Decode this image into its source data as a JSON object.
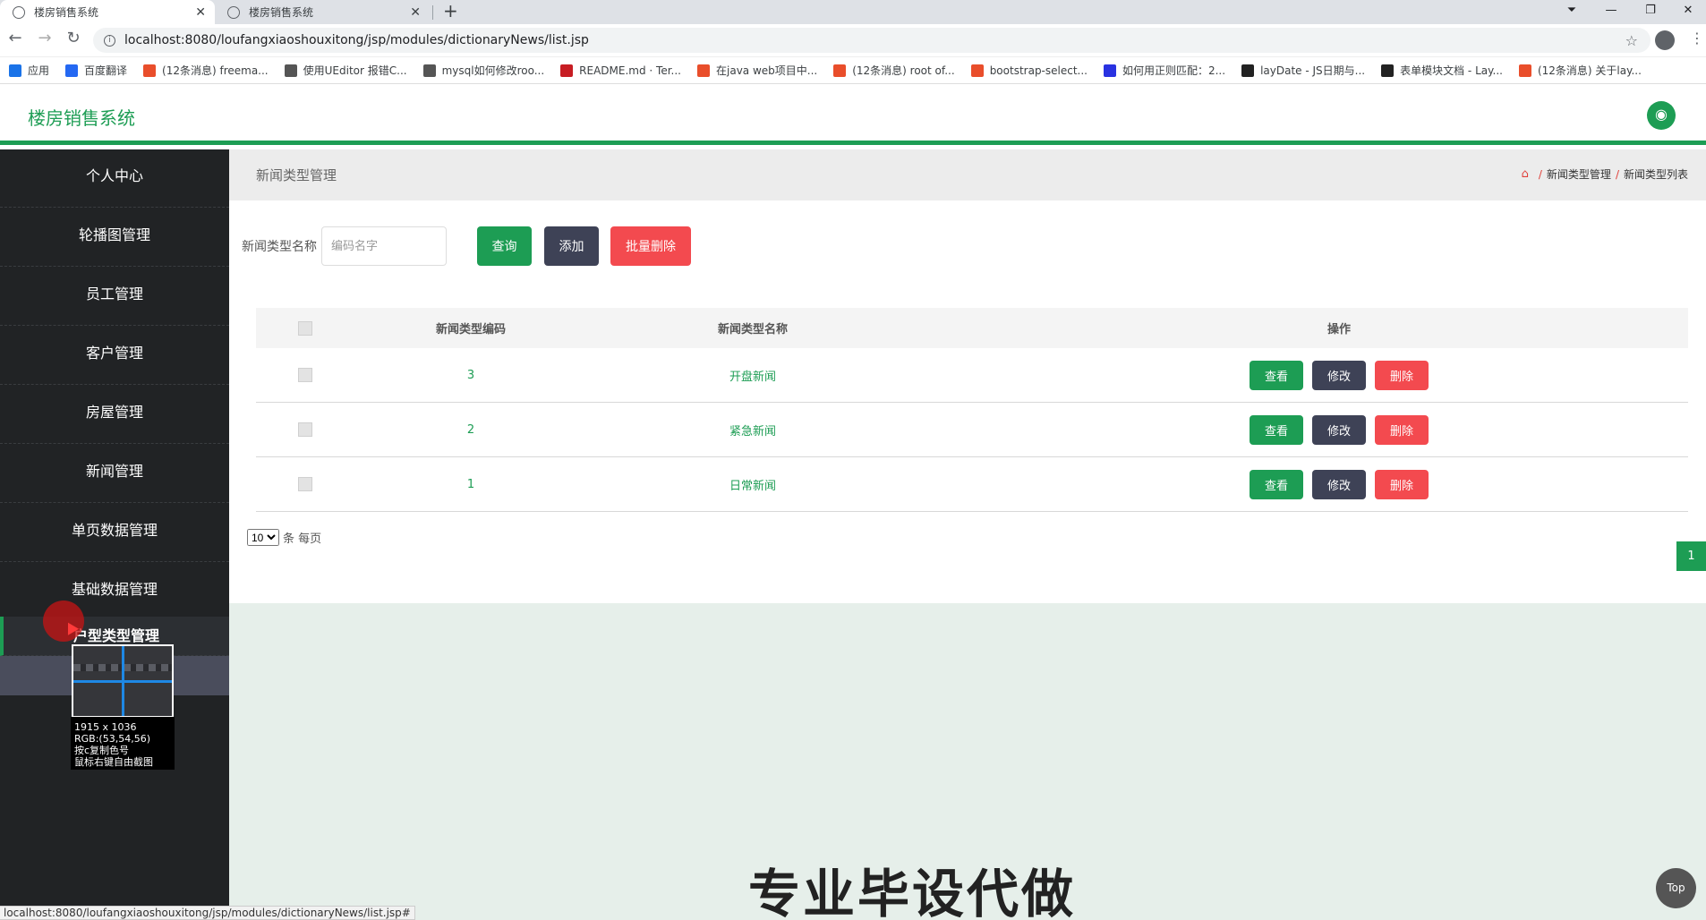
{
  "browser": {
    "tabs": [
      {
        "title": "楼房销售系统",
        "active": true
      },
      {
        "title": "楼房销售系统",
        "active": false
      }
    ],
    "new_tab": "+",
    "url": "localhost:8080/loufangxiaoshouxitong/jsp/modules/dictionaryNews/list.jsp",
    "bookmarks": [
      {
        "label": "应用",
        "icon": "apps-grid-icon",
        "color": "#1a73e8"
      },
      {
        "label": "百度翻译",
        "icon": "baidu-translate-icon",
        "color": "#2468f2"
      },
      {
        "label": "(12条消息) freema...",
        "icon": "csdn-icon",
        "color": "#e94e2b"
      },
      {
        "label": "使用UEditor 报错C...",
        "icon": "ueditor-icon",
        "color": "#555555"
      },
      {
        "label": "mysql如何修改roo...",
        "icon": "mysql-icon",
        "color": "#555555"
      },
      {
        "label": "README.md · Ter...",
        "icon": "gitee-icon",
        "color": "#c71d23"
      },
      {
        "label": "在java web项目中...",
        "icon": "csdn-icon",
        "color": "#e94e2b"
      },
      {
        "label": "(12条消息) root of...",
        "icon": "csdn-icon",
        "color": "#e94e2b"
      },
      {
        "label": "bootstrap-select...",
        "icon": "bootstrap-icon",
        "color": "#e94e2b"
      },
      {
        "label": "如何用正则匹配：2...",
        "icon": "baidu-icon",
        "color": "#2932e1"
      },
      {
        "label": "layDate - JS日期与...",
        "icon": "layui-icon",
        "color": "#222222"
      },
      {
        "label": "表单模块文档 - Lay...",
        "icon": "layui-icon",
        "color": "#222222"
      },
      {
        "label": "(12条消息) 关于lay...",
        "icon": "csdn-icon",
        "color": "#e94e2b"
      }
    ],
    "status_url": "localhost:8080/loufangxiaoshouxitong/jsp/modules/dictionaryNews/list.jsp#"
  },
  "app": {
    "title": "楼房销售系统",
    "accent": "#1d9d54"
  },
  "sidebar": {
    "items": [
      {
        "label": "个人中心"
      },
      {
        "label": "轮播图管理"
      },
      {
        "label": "员工管理"
      },
      {
        "label": "客户管理"
      },
      {
        "label": "房屋管理"
      },
      {
        "label": "新闻管理"
      },
      {
        "label": "单页数据管理"
      },
      {
        "label": "基础数据管理"
      },
      {
        "label": "户型类型管理"
      }
    ]
  },
  "screenshot_tool": {
    "size": "1915 x 1036",
    "rgb": "RGB:(53,54,56)",
    "hint1": "按c复制色号",
    "hint2": "鼠标右键自由截图"
  },
  "page": {
    "title": "新闻类型管理",
    "breadcrumb": [
      "新闻类型管理",
      "新闻类型列表"
    ],
    "search_label": "新闻类型名称",
    "search_placeholder": "编码名字",
    "search_button": "查询",
    "add_button": "添加",
    "batch_delete_button": "批量删除"
  },
  "table": {
    "headers": [
      "新闻类型编码",
      "新闻类型名称",
      "操作"
    ],
    "rows": [
      {
        "code": "3",
        "name": "开盘新闻"
      },
      {
        "code": "2",
        "name": "紧急新闻"
      },
      {
        "code": "1",
        "name": "日常新闻"
      }
    ],
    "actions": {
      "view": "查看",
      "edit": "修改",
      "delete": "删除"
    }
  },
  "pager": {
    "page_size": "10",
    "per_page_label": "条 每页",
    "current_page": "1"
  },
  "watermark": "专业毕设代做",
  "top_button": "Top"
}
